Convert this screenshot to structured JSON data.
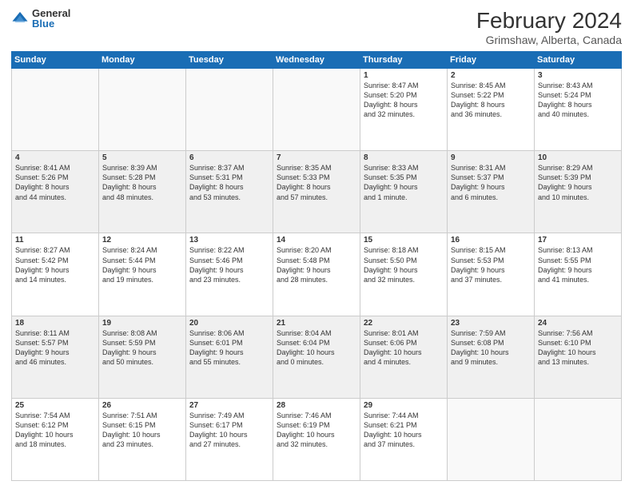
{
  "header": {
    "logo_general": "General",
    "logo_blue": "Blue",
    "month_year": "February 2024",
    "location": "Grimshaw, Alberta, Canada"
  },
  "days_of_week": [
    "Sunday",
    "Monday",
    "Tuesday",
    "Wednesday",
    "Thursday",
    "Friday",
    "Saturday"
  ],
  "weeks": [
    [
      {
        "day": "",
        "info": ""
      },
      {
        "day": "",
        "info": ""
      },
      {
        "day": "",
        "info": ""
      },
      {
        "day": "",
        "info": ""
      },
      {
        "day": "1",
        "info": "Sunrise: 8:47 AM\nSunset: 5:20 PM\nDaylight: 8 hours\nand 32 minutes."
      },
      {
        "day": "2",
        "info": "Sunrise: 8:45 AM\nSunset: 5:22 PM\nDaylight: 8 hours\nand 36 minutes."
      },
      {
        "day": "3",
        "info": "Sunrise: 8:43 AM\nSunset: 5:24 PM\nDaylight: 8 hours\nand 40 minutes."
      }
    ],
    [
      {
        "day": "4",
        "info": "Sunrise: 8:41 AM\nSunset: 5:26 PM\nDaylight: 8 hours\nand 44 minutes."
      },
      {
        "day": "5",
        "info": "Sunrise: 8:39 AM\nSunset: 5:28 PM\nDaylight: 8 hours\nand 48 minutes."
      },
      {
        "day": "6",
        "info": "Sunrise: 8:37 AM\nSunset: 5:31 PM\nDaylight: 8 hours\nand 53 minutes."
      },
      {
        "day": "7",
        "info": "Sunrise: 8:35 AM\nSunset: 5:33 PM\nDaylight: 8 hours\nand 57 minutes."
      },
      {
        "day": "8",
        "info": "Sunrise: 8:33 AM\nSunset: 5:35 PM\nDaylight: 9 hours\nand 1 minute."
      },
      {
        "day": "9",
        "info": "Sunrise: 8:31 AM\nSunset: 5:37 PM\nDaylight: 9 hours\nand 6 minutes."
      },
      {
        "day": "10",
        "info": "Sunrise: 8:29 AM\nSunset: 5:39 PM\nDaylight: 9 hours\nand 10 minutes."
      }
    ],
    [
      {
        "day": "11",
        "info": "Sunrise: 8:27 AM\nSunset: 5:42 PM\nDaylight: 9 hours\nand 14 minutes."
      },
      {
        "day": "12",
        "info": "Sunrise: 8:24 AM\nSunset: 5:44 PM\nDaylight: 9 hours\nand 19 minutes."
      },
      {
        "day": "13",
        "info": "Sunrise: 8:22 AM\nSunset: 5:46 PM\nDaylight: 9 hours\nand 23 minutes."
      },
      {
        "day": "14",
        "info": "Sunrise: 8:20 AM\nSunset: 5:48 PM\nDaylight: 9 hours\nand 28 minutes."
      },
      {
        "day": "15",
        "info": "Sunrise: 8:18 AM\nSunset: 5:50 PM\nDaylight: 9 hours\nand 32 minutes."
      },
      {
        "day": "16",
        "info": "Sunrise: 8:15 AM\nSunset: 5:53 PM\nDaylight: 9 hours\nand 37 minutes."
      },
      {
        "day": "17",
        "info": "Sunrise: 8:13 AM\nSunset: 5:55 PM\nDaylight: 9 hours\nand 41 minutes."
      }
    ],
    [
      {
        "day": "18",
        "info": "Sunrise: 8:11 AM\nSunset: 5:57 PM\nDaylight: 9 hours\nand 46 minutes."
      },
      {
        "day": "19",
        "info": "Sunrise: 8:08 AM\nSunset: 5:59 PM\nDaylight: 9 hours\nand 50 minutes."
      },
      {
        "day": "20",
        "info": "Sunrise: 8:06 AM\nSunset: 6:01 PM\nDaylight: 9 hours\nand 55 minutes."
      },
      {
        "day": "21",
        "info": "Sunrise: 8:04 AM\nSunset: 6:04 PM\nDaylight: 10 hours\nand 0 minutes."
      },
      {
        "day": "22",
        "info": "Sunrise: 8:01 AM\nSunset: 6:06 PM\nDaylight: 10 hours\nand 4 minutes."
      },
      {
        "day": "23",
        "info": "Sunrise: 7:59 AM\nSunset: 6:08 PM\nDaylight: 10 hours\nand 9 minutes."
      },
      {
        "day": "24",
        "info": "Sunrise: 7:56 AM\nSunset: 6:10 PM\nDaylight: 10 hours\nand 13 minutes."
      }
    ],
    [
      {
        "day": "25",
        "info": "Sunrise: 7:54 AM\nSunset: 6:12 PM\nDaylight: 10 hours\nand 18 minutes."
      },
      {
        "day": "26",
        "info": "Sunrise: 7:51 AM\nSunset: 6:15 PM\nDaylight: 10 hours\nand 23 minutes."
      },
      {
        "day": "27",
        "info": "Sunrise: 7:49 AM\nSunset: 6:17 PM\nDaylight: 10 hours\nand 27 minutes."
      },
      {
        "day": "28",
        "info": "Sunrise: 7:46 AM\nSunset: 6:19 PM\nDaylight: 10 hours\nand 32 minutes."
      },
      {
        "day": "29",
        "info": "Sunrise: 7:44 AM\nSunset: 6:21 PM\nDaylight: 10 hours\nand 37 minutes."
      },
      {
        "day": "",
        "info": ""
      },
      {
        "day": "",
        "info": ""
      }
    ]
  ]
}
